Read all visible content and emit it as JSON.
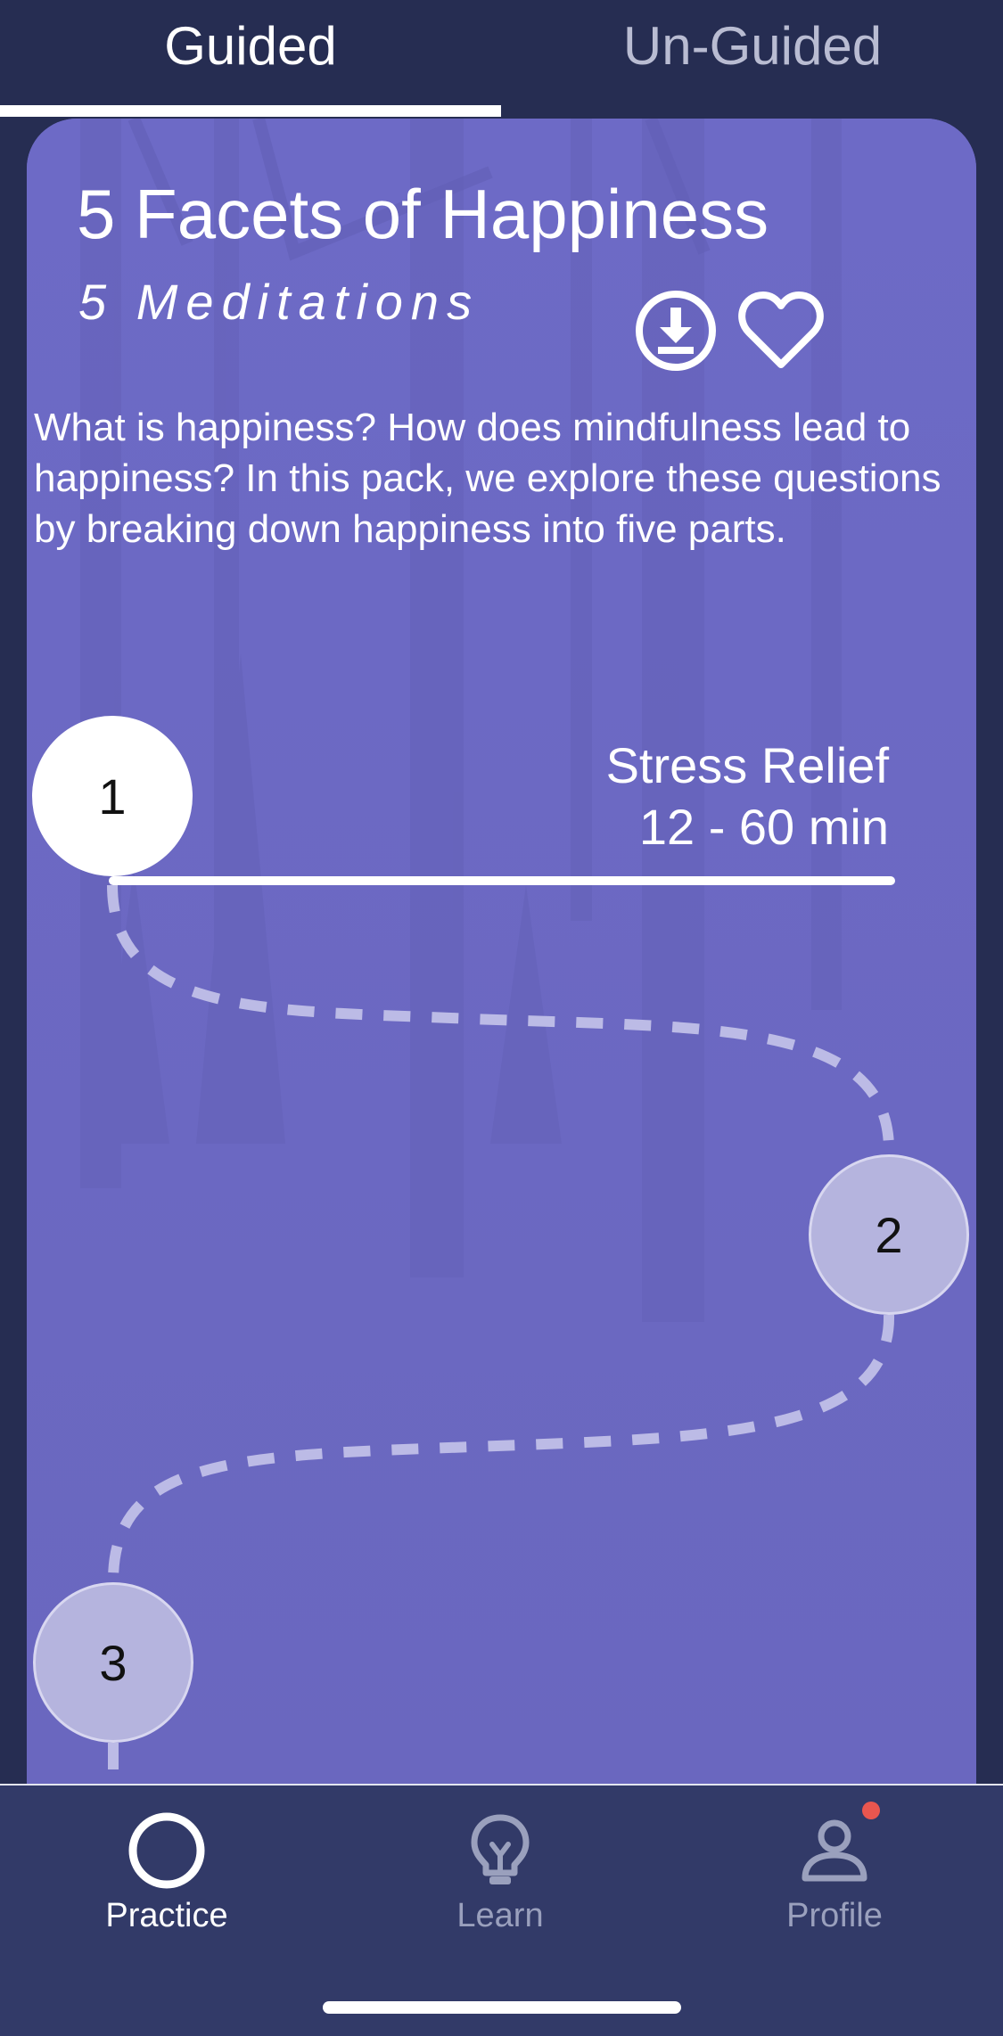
{
  "tabs": {
    "guided_label": "Guided",
    "unguided_label": "Un-Guided",
    "active": "Guided"
  },
  "pack": {
    "title": "5 Facets of Happiness",
    "subtitle": "5 Meditations",
    "description": "What is happiness? How does mindfulness lead to happiness? In this pack, we explore these questions by breaking down happiness into five parts.",
    "download_icon": "download-icon",
    "favorite_icon": "heart-icon"
  },
  "stages": [
    {
      "number": "1",
      "title": "Stress Relief",
      "duration": "12 - 60 min",
      "state": "active"
    },
    {
      "number": "2",
      "state": "locked"
    },
    {
      "number": "3",
      "state": "locked"
    }
  ],
  "nav": {
    "items": [
      {
        "label": "Practice",
        "icon": "circle-icon",
        "active": true
      },
      {
        "label": "Learn",
        "icon": "lightbulb-icon",
        "active": false
      },
      {
        "label": "Profile",
        "icon": "person-icon",
        "active": false,
        "has_notification": true
      }
    ]
  },
  "colors": {
    "background": "#262d52",
    "card": "#6c69c2",
    "node_locked": "#b5b4de",
    "nav_background": "#323a68",
    "notification": "#e9564f"
  }
}
